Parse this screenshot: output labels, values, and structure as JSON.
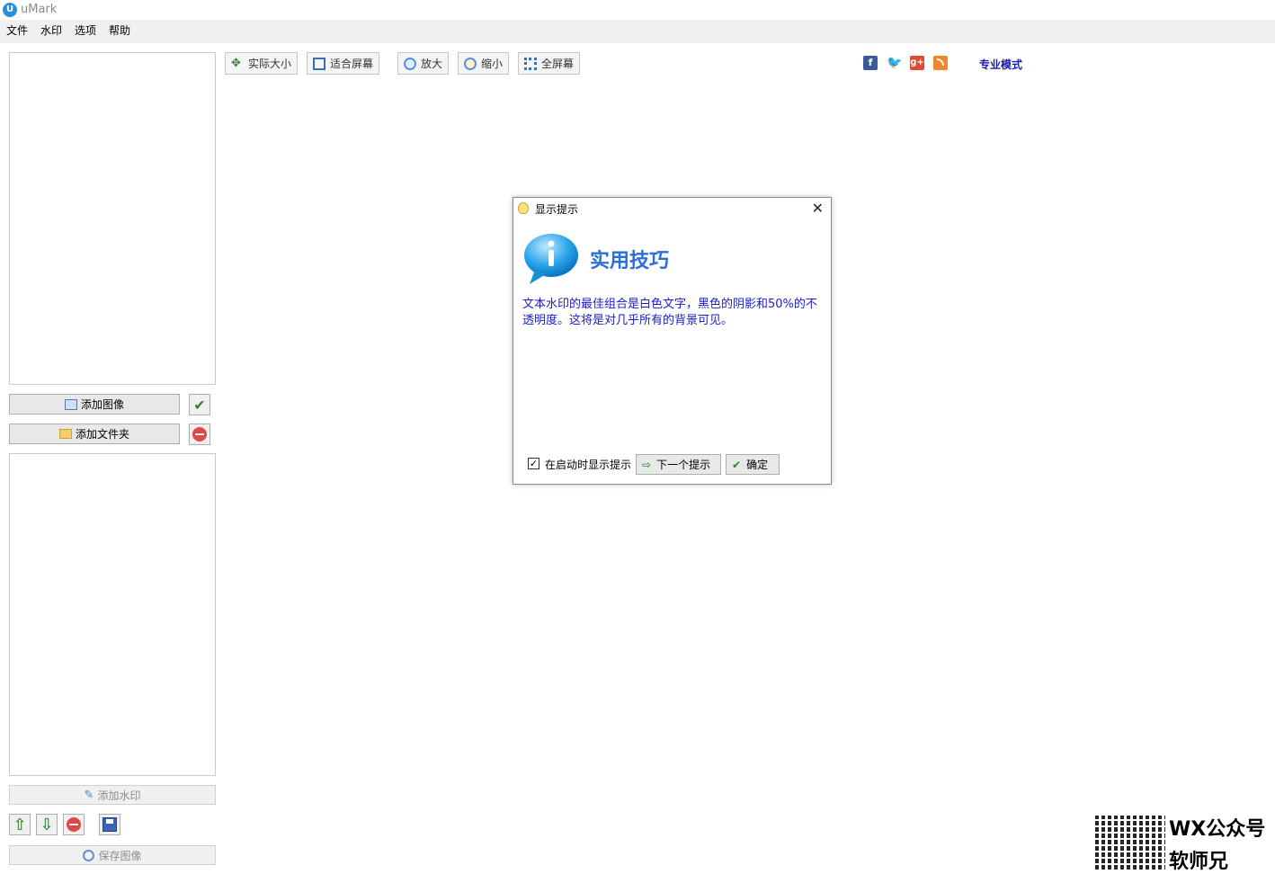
{
  "window": {
    "title": "uMark"
  },
  "menu": [
    "文件",
    "水印",
    "选项",
    "帮助"
  ],
  "left_panel": {
    "add_image": "添加图像",
    "add_folder": "添加文件夹",
    "add_watermark": "添加水印",
    "save_image": "保存图像"
  },
  "toolbar": {
    "actual_size": "实际大小",
    "fit_screen": "适合屏幕",
    "zoom_in": "放大",
    "zoom_out": "缩小",
    "fullscreen": "全屏幕",
    "pro_mode": "专业模式"
  },
  "social": {
    "facebook": "f",
    "googleplus": "g+"
  },
  "dialog": {
    "title": "显示提示",
    "heading": "实用技巧",
    "body": "文本水印的最佳组合是白色文字，黑色的阴影和50%的不透明度。这将是对几乎所有的背景可见。",
    "show_on_startup": "在启动时显示提示",
    "show_on_startup_checked": true,
    "next_tip": "下一个提示",
    "ok": "确定"
  },
  "watermark_overlay": {
    "line1": "WX公众号",
    "line2": "软师兄"
  },
  "colors": {
    "accent": "#2a6fd6",
    "tip_text": "#1a1acc",
    "pro_link": "#1a1aa6"
  }
}
